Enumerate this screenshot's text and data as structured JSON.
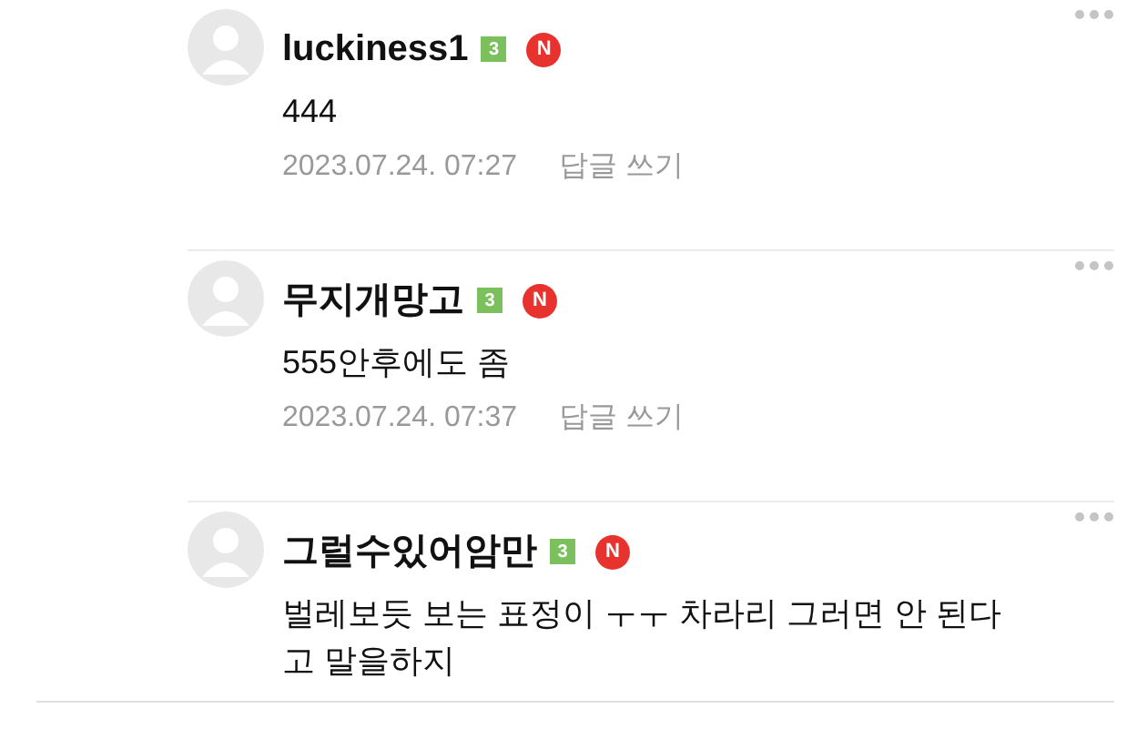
{
  "comments": [
    {
      "author": "luckiness1",
      "level_badge": "3",
      "new_badge": "N",
      "body": "444",
      "date": "2023.07.24. 07:27",
      "reply": "답글 쓰기"
    },
    {
      "author": "무지개망고",
      "level_badge": "3",
      "new_badge": "N",
      "body": "555안후에도 좀",
      "date": "2023.07.24. 07:37",
      "reply": "답글 쓰기"
    },
    {
      "author": "그럴수있어암만",
      "level_badge": "3",
      "new_badge": "N",
      "body": "벌레보듯 보는 표정이 ㅜㅜ 차라리 그러면 안 된다고 말을하지"
    }
  ]
}
